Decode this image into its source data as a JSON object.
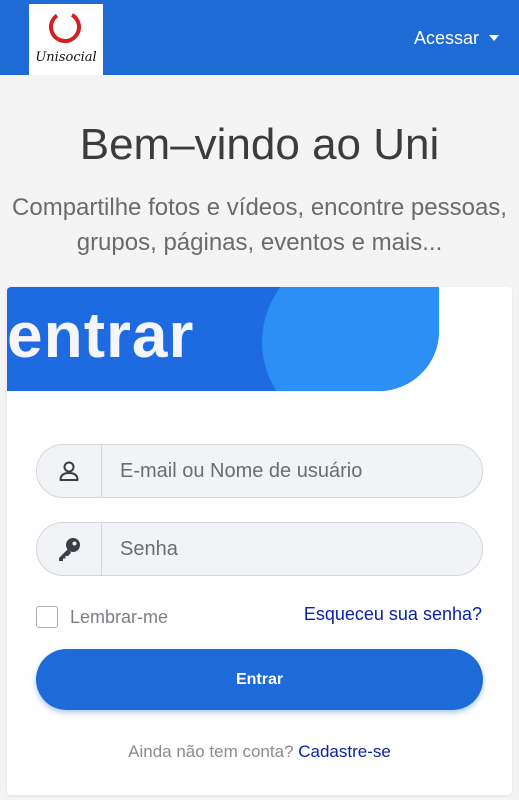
{
  "header": {
    "logo_text": "Unisocial",
    "access_label": "Acessar"
  },
  "hero": {
    "title": "Bem–vindo ao Uni",
    "subtitle": "Compartilhe fotos e vídeos, encontre pessoas, grupos, páginas, eventos e mais..."
  },
  "login": {
    "banner_title": "entrar",
    "username_placeholder": "E-mail ou Nome de usuário",
    "password_placeholder": "Senha",
    "remember_label": "Lembrar-me",
    "forgot_label": "Esqueceu sua senha?",
    "submit_label": "Entrar",
    "signup_prompt": "Ainda não tem conta?",
    "signup_link": "Cadastre-se"
  },
  "icons": {
    "user": "user-icon",
    "password": "key-icon",
    "dropdown": "caret-down-icon",
    "logo": "unisocial-logo"
  },
  "colors": {
    "brand_blue": "#1e6bd6",
    "link_blue": "#0a23a8",
    "logo_red": "#d42020"
  }
}
